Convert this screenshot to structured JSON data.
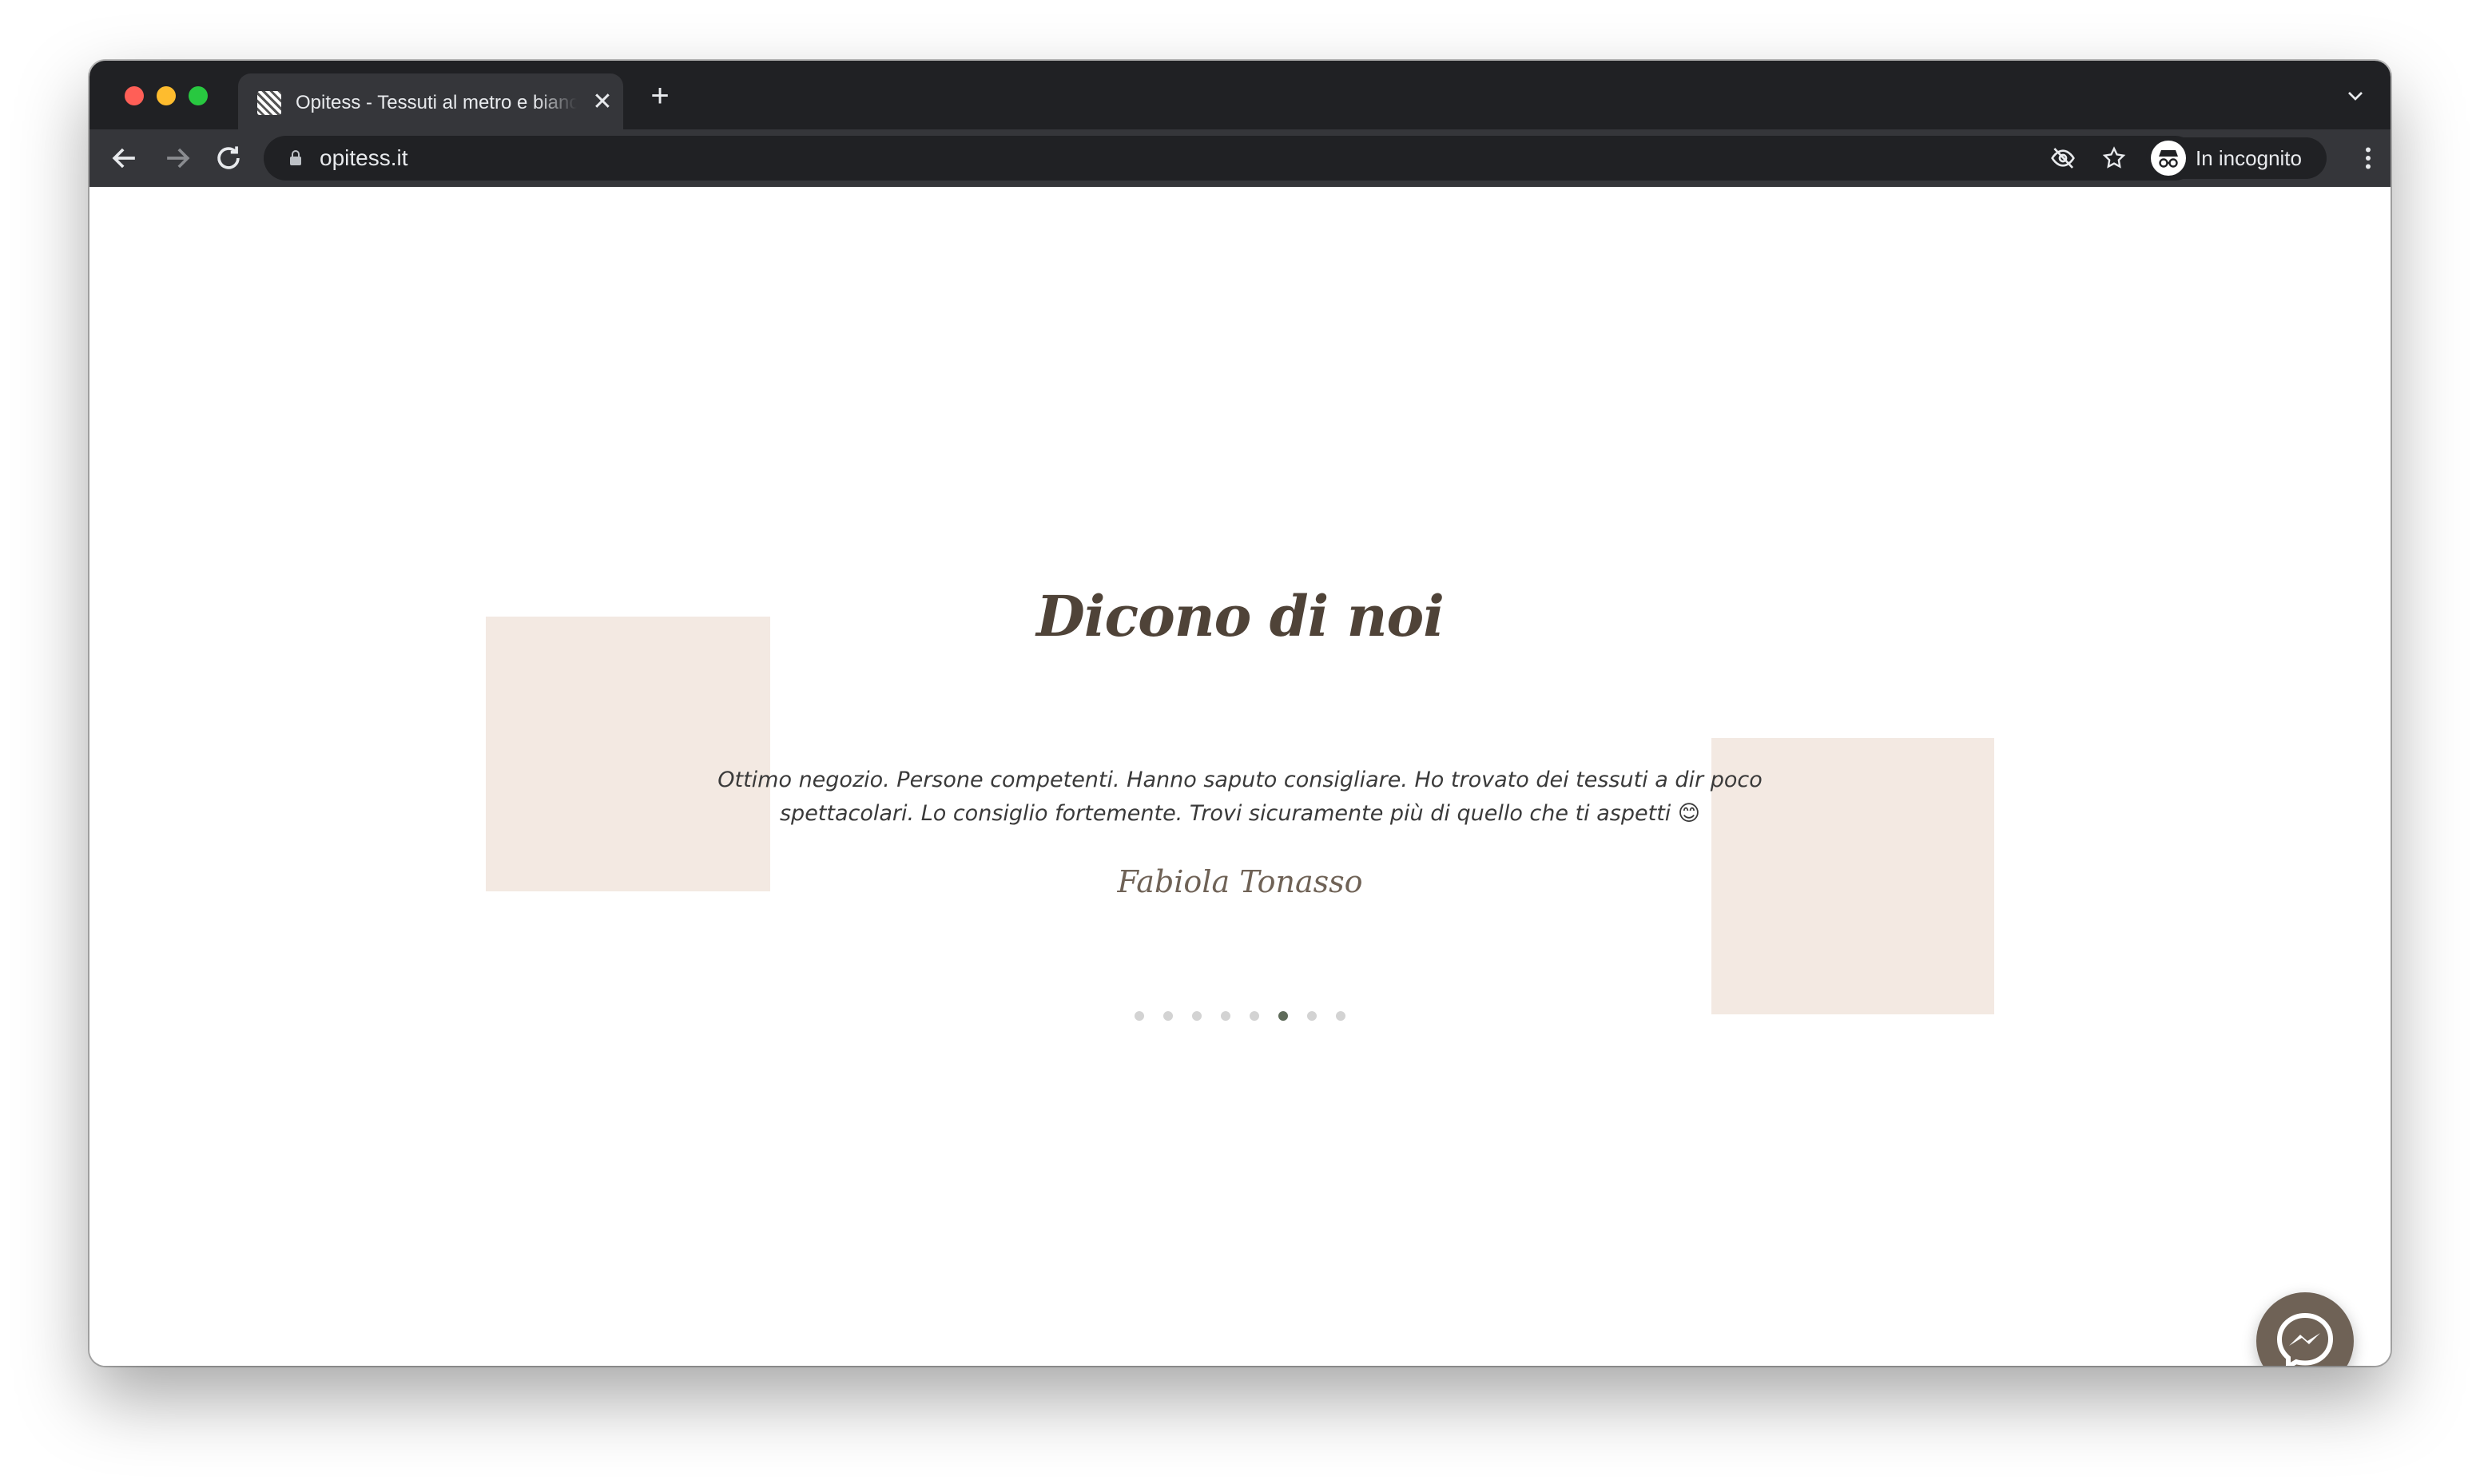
{
  "browser": {
    "tab": {
      "title": "Opitess - Tessuti al metro e biancheria",
      "close_symbol": "✕"
    },
    "new_tab_symbol": "+",
    "address_bar": {
      "url": "opitess.it"
    },
    "profile": {
      "label": "In incognito"
    },
    "icons": [
      "back-icon",
      "forward-icon",
      "reload-icon",
      "lock-icon",
      "eye-off-icon",
      "star-icon",
      "incognito-icon",
      "more-menu-icon",
      "tab-search-icon"
    ]
  },
  "page": {
    "heading": "Dicono di noi",
    "testimonial": {
      "text": "Ottimo negozio. Persone competenti. Hanno saputo consigliare. Ho trovato dei tessuti a dir poco spettacolari. Lo consiglio fortemente. Trovi sicuramente più di quello che ti aspetti 😊",
      "author": "Fabiola Tonasso"
    },
    "carousel": {
      "slide_count": 8,
      "active_index": 5
    },
    "messenger_button": {
      "icon": "messenger-icon"
    }
  },
  "colors": {
    "heading": "#4f4338",
    "author": "#6f6256",
    "decor_block": "#f3e9e2",
    "dot_active": "#5f6b5a",
    "dot_inactive": "#d3d3d3",
    "messenger_bg": "#6f6256",
    "chrome_dark": "#202124",
    "chrome_tab": "#35363a"
  }
}
